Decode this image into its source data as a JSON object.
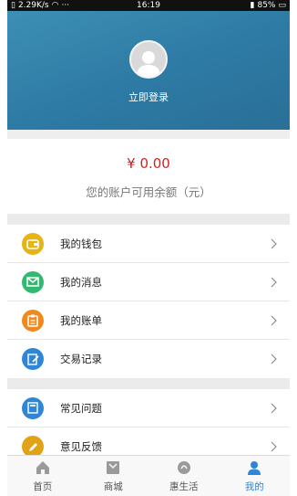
{
  "status_bar": {
    "network_speed": "2.29K/s",
    "extra": "···",
    "time": "16:19",
    "battery": "85%"
  },
  "profile": {
    "login_label": "立即登录"
  },
  "balance": {
    "amount": "¥ 0.00",
    "label": "您的账户可用余额（元）"
  },
  "menu_group_1": [
    {
      "label": "我的钱包",
      "icon": "wallet-icon",
      "color": "#e7b416"
    },
    {
      "label": "我的消息",
      "icon": "mail-icon",
      "color": "#33b872"
    },
    {
      "label": "我的账单",
      "icon": "bill-icon",
      "color": "#ef8a1f"
    },
    {
      "label": "交易记录",
      "icon": "record-icon",
      "color": "#2f86d6"
    }
  ],
  "menu_group_2": [
    {
      "label": "常见问题",
      "icon": "faq-icon",
      "color": "#2f86d6"
    },
    {
      "label": "意见反馈",
      "icon": "feedback-icon",
      "color": "#e0a318"
    }
  ],
  "bottom_nav": [
    {
      "label": "首页",
      "icon": "home-icon",
      "active": false
    },
    {
      "label": "商城",
      "icon": "mall-icon",
      "active": false
    },
    {
      "label": "惠生活",
      "icon": "life-icon",
      "active": false
    },
    {
      "label": "我的",
      "icon": "person-icon",
      "active": true
    }
  ],
  "colors": {
    "header": "#2f7ea8",
    "accent": "#2f86d6",
    "price": "#d81e1e"
  }
}
